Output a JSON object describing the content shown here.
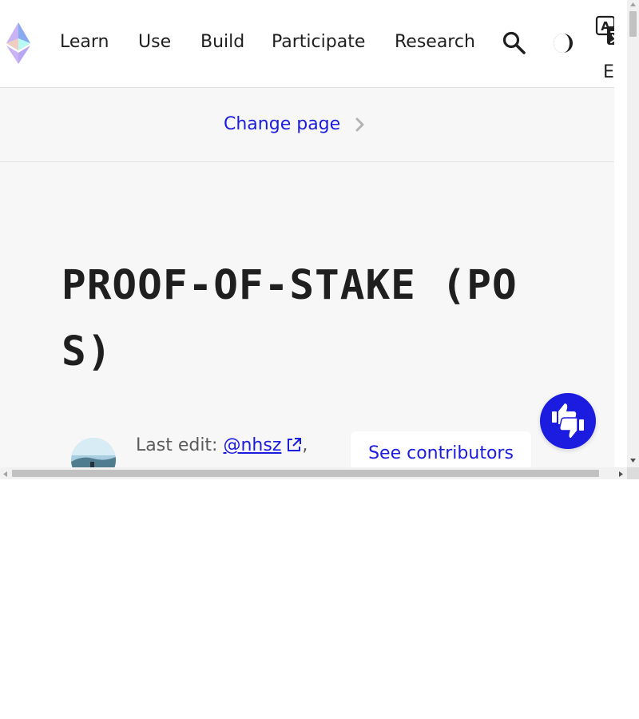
{
  "header": {
    "logo_icon": "ethereum-logo-icon",
    "nav": {
      "learn": "Learn",
      "use": "Use",
      "build": "Build",
      "participate": "Participate",
      "research": "Research"
    },
    "search_icon": "search-icon",
    "theme_icon": "dark-mode-icon",
    "language_icon": "translate-icon",
    "language_code": "EN"
  },
  "change_page": {
    "label": "Change page",
    "icon": "chevron-right-icon"
  },
  "article": {
    "title": "PROOF-OF-STAKE (POS)",
    "last_edit_label": "Last edit:",
    "last_edit_user": "@nhsz",
    "last_edit_suffix": ",",
    "contributors_button": "See contributors"
  },
  "feedback": {
    "icon": "thumbs-up-down-icon"
  },
  "colors": {
    "accent": "#1c1ce1",
    "text": "#1f1f1f",
    "muted_text": "#5b5b5b",
    "page_background": "#f7f7f7",
    "header_background": "#ffffff"
  }
}
